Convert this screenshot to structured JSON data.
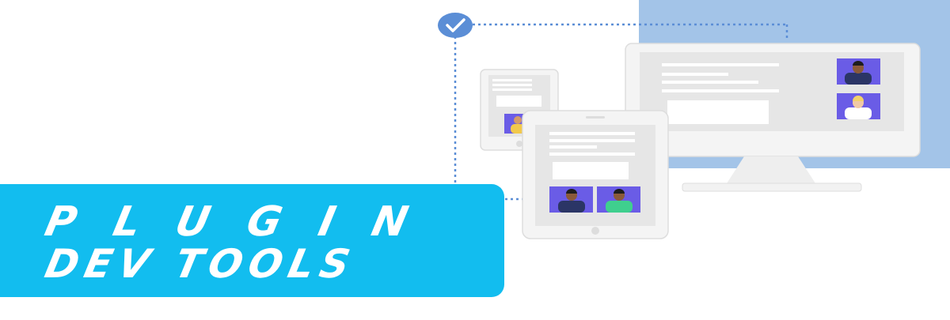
{
  "banner": {
    "line1": "PLUGIN",
    "line2": "DEV TOOLS"
  },
  "colors": {
    "banner": "#12bdef",
    "accent_block": "#a3c4e8",
    "check_badge": "#5b8ed6",
    "device_frame": "#f4f4f4",
    "screen": "#e7e7e7",
    "avatar_tile": "#6a5ce6",
    "dotted_line": "#5b8ed6"
  },
  "icons": [
    "check-icon",
    "avatar-icon"
  ]
}
